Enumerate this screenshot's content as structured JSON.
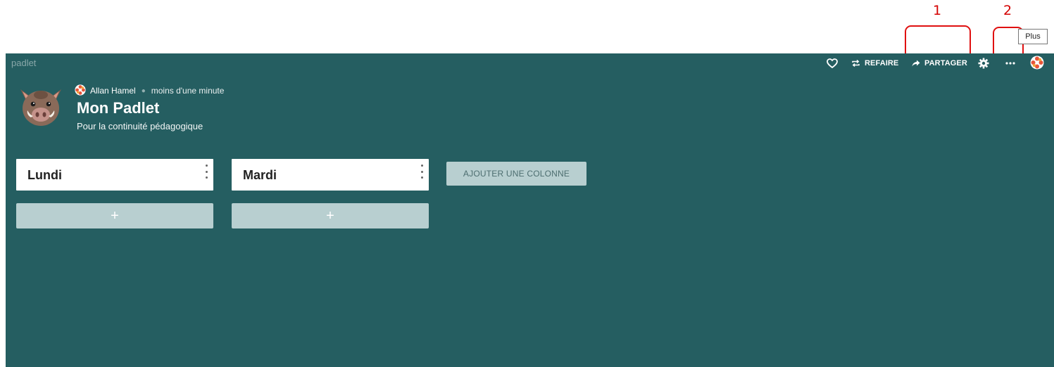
{
  "annotations": [
    {
      "number": "1",
      "target": "partager-button"
    },
    {
      "number": "2",
      "target": "more-button"
    }
  ],
  "topbar": {
    "brand": "padlet",
    "items": [
      {
        "name": "like-button",
        "icon": "heart-icon"
      },
      {
        "name": "remake-button",
        "icon": "repeat-icon",
        "label": "REFAIRE"
      },
      {
        "name": "share-button",
        "icon": "share-arrow-icon",
        "label": "PARTAGER"
      },
      {
        "name": "settings-button",
        "icon": "gear-icon"
      },
      {
        "name": "more-button",
        "icon": "ellipsis-icon"
      },
      {
        "name": "user-menu-button",
        "icon": "padlet-flower-icon"
      }
    ],
    "tooltip": "Plus"
  },
  "header": {
    "avatar_icon": "boar-icon",
    "author": "Allan Hamel",
    "time": "moins d'une minute",
    "title": "Mon Padlet",
    "subtitle": "Pour la continuité pédagogique"
  },
  "columns": [
    {
      "title": "Lundi",
      "add_label": "+"
    },
    {
      "title": "Mardi",
      "add_label": "+"
    }
  ],
  "add_column_label": "AJOUTER UNE COLONNE",
  "colors": {
    "background": "#255e61",
    "add_button": "#b8cfd0",
    "annotation": "#e01010",
    "brand_accent": "#e8553a"
  }
}
